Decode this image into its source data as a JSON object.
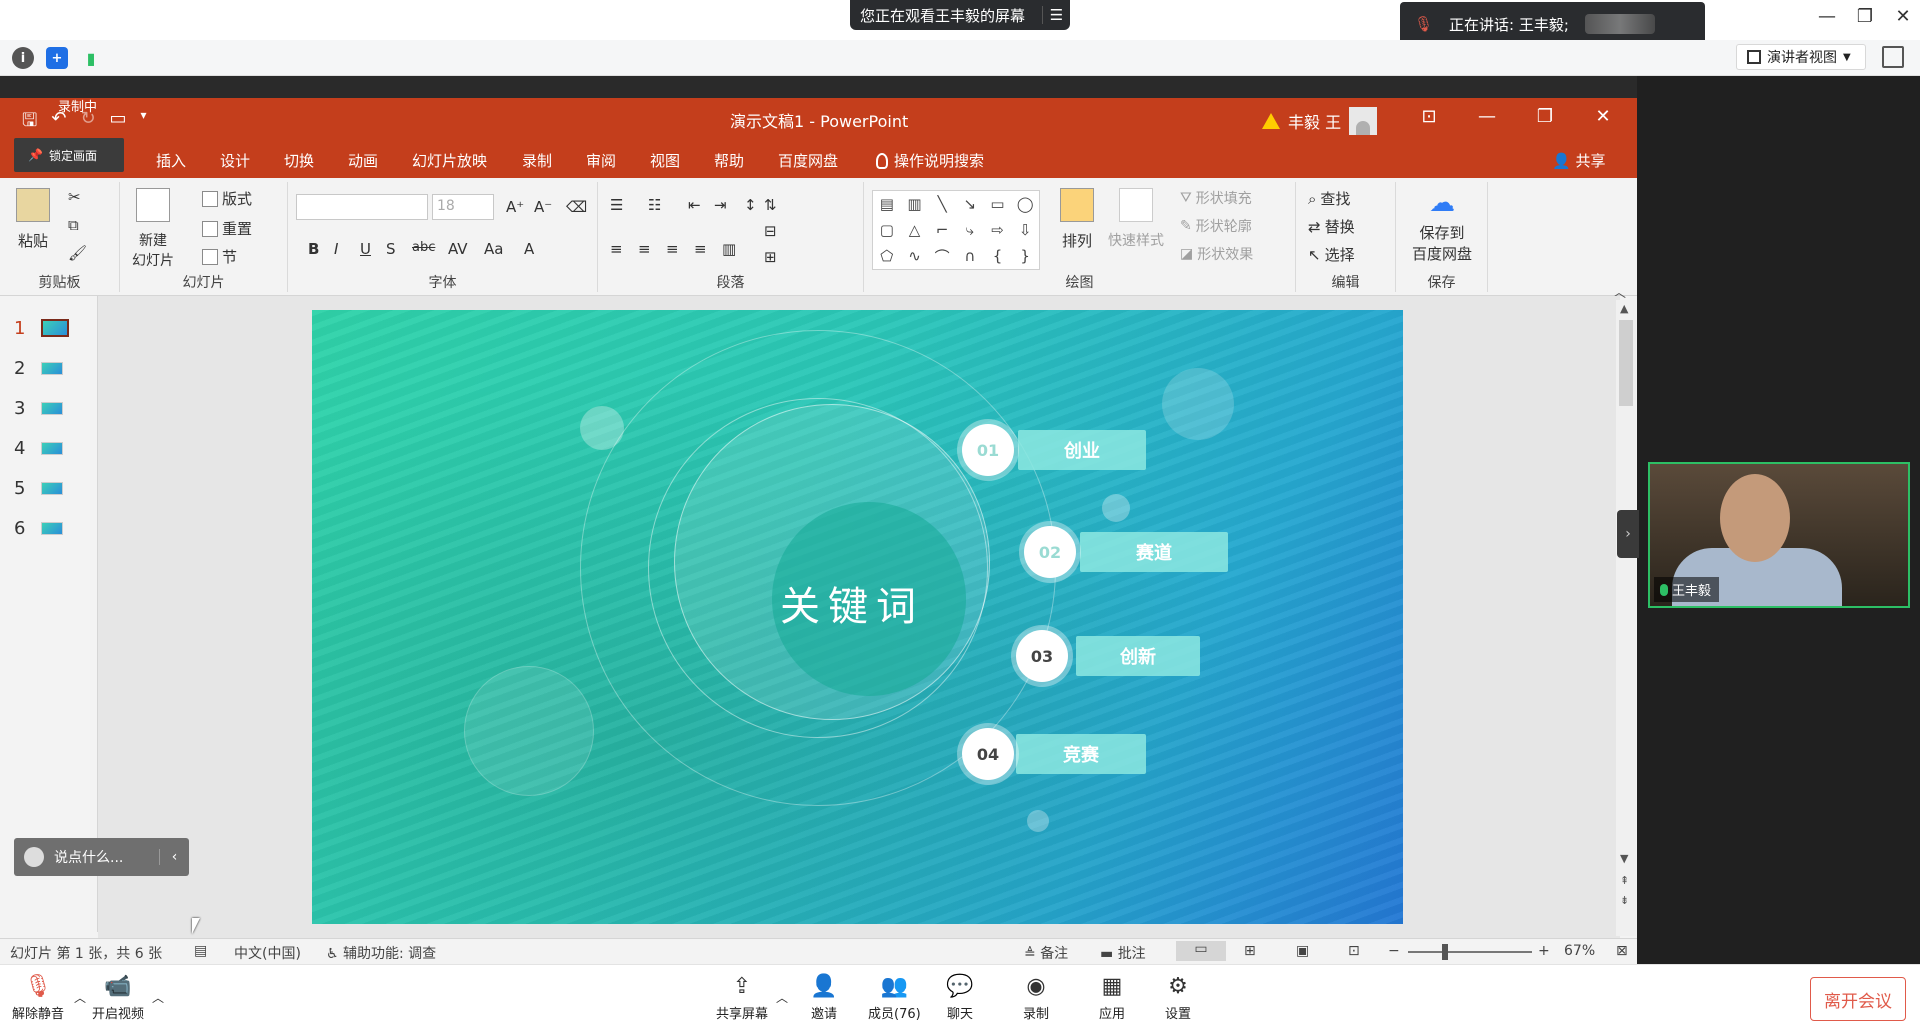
{
  "meeting": {
    "viewing_banner": "您正在观看王丰毅的屏幕",
    "speaking_banner": "正在讲话: 王丰毅;",
    "presenter_view": "演讲者视图",
    "toolbar_left": [
      "info-icon",
      "shield-icon",
      "signal-icon"
    ],
    "bottom": {
      "unmute": "解除静音",
      "start_video": "开启视频",
      "share": "共享屏幕",
      "invite": "邀请",
      "members": "成员(76)",
      "chat": "聊天",
      "record": "录制",
      "apps": "应用",
      "settings": "设置",
      "leave": "离开会议"
    },
    "video_name": "王丰毅",
    "comment_placeholder": "说点什么...",
    "colors": {
      "accent_green": "#2dbf65",
      "leave_red": "#e05a4a"
    }
  },
  "ppt": {
    "title": "演示文稿1  -  PowerPoint",
    "user": "丰毅 王",
    "recording": "录制中",
    "lock_tip": "锁定画面",
    "share": "共享",
    "tabs": [
      "插入",
      "设计",
      "切换",
      "动画",
      "幻灯片放映",
      "录制",
      "审阅",
      "视图",
      "帮助",
      "百度网盘"
    ],
    "tell_me": "操作说明搜索",
    "ribbon": {
      "paste": "粘贴",
      "clipboard": "剪贴板",
      "new_slide": "新建\n幻灯片",
      "layout": "版式",
      "reset": "重置",
      "section": "节",
      "slides": "幻灯片",
      "font_size": "18",
      "font": "字体",
      "paragraph": "段落",
      "arrange": "排列",
      "quick_styles": "快速样式",
      "shape_fill": "形状填充",
      "shape_outline": "形状轮廓",
      "shape_effects": "形状效果",
      "drawing": "绘图",
      "find": "查找",
      "replace": "替换",
      "select": "选择",
      "editing": "编辑",
      "save_baidu": "保存到\n百度网盘",
      "save": "保存"
    },
    "thumbnails": [
      "1",
      "2",
      "3",
      "4",
      "5",
      "6"
    ],
    "slide": {
      "keyword": "关键词",
      "items": [
        {
          "num": "01",
          "label": "创业"
        },
        {
          "num": "02",
          "label": "赛道"
        },
        {
          "num": "03",
          "label": "创新"
        },
        {
          "num": "04",
          "label": "竞赛"
        }
      ]
    },
    "status": {
      "slide_info": "幻灯片 第 1 张，共 6 张",
      "language": "中文(中国)",
      "accessibility": "辅助功能: 调查",
      "notes": "备注",
      "comments": "批注",
      "zoom": "67%"
    },
    "colors": {
      "title_bar": "#c43e1c"
    }
  }
}
